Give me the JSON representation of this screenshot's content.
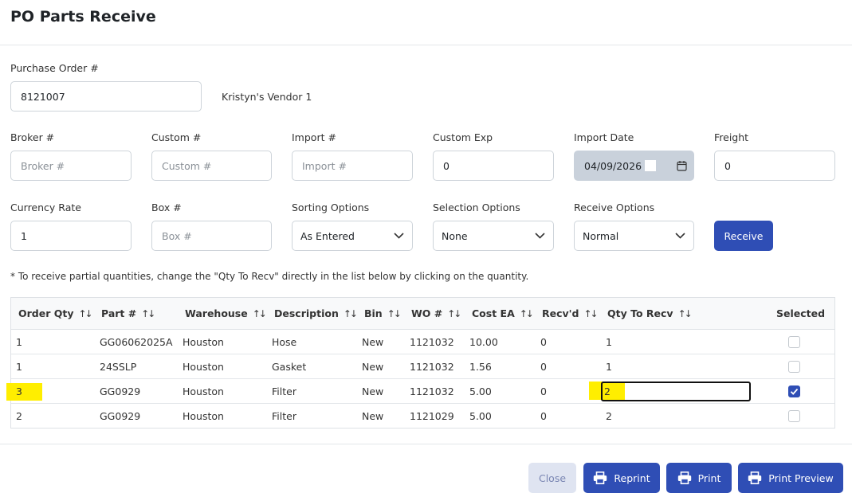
{
  "page": {
    "title": "PO Parts Receive"
  },
  "po": {
    "label": "Purchase Order #",
    "value": "8121007",
    "vendor": "Kristyn's Vendor 1"
  },
  "fields": {
    "broker": {
      "label": "Broker #",
      "placeholder": "Broker #",
      "value": ""
    },
    "custom": {
      "label": "Custom #",
      "placeholder": "Custom #",
      "value": ""
    },
    "import": {
      "label": "Import #",
      "placeholder": "Import #",
      "value": ""
    },
    "custom_exp": {
      "label": "Custom Exp",
      "value": "0"
    },
    "import_date": {
      "label": "Import Date",
      "value": "04/09/2026"
    },
    "freight": {
      "label": "Freight",
      "value": "0"
    },
    "currency_rate": {
      "label": "Currency Rate",
      "value": "1"
    },
    "box": {
      "label": "Box #",
      "placeholder": "Box #",
      "value": ""
    }
  },
  "options": {
    "sorting": {
      "label": "Sorting Options",
      "selected": "As Entered"
    },
    "selection": {
      "label": "Selection Options",
      "selected": "None"
    },
    "receive": {
      "label": "Receive Options",
      "selected": "Normal"
    },
    "receive_button": "Receive"
  },
  "note": "* To receive partial quantities, change the \"Qty To Recv\" directly in the list below by clicking on the quantity.",
  "table": {
    "sort_glyph": "↑↓",
    "headers": {
      "order_qty": "Order Qty",
      "part": "Part #",
      "warehouse": "Warehouse",
      "description": "Description",
      "bin": "Bin",
      "wo": "WO #",
      "cost": "Cost EA",
      "recvd": "Recv'd",
      "qty_to_recv": "Qty To Recv",
      "selected": "Selected"
    },
    "rows": [
      {
        "order_qty": "1",
        "part": "GG06062025A",
        "warehouse": "Houston",
        "description": "Hose",
        "bin": "New",
        "wo": "1121032",
        "cost": "10.00",
        "recvd": "0",
        "qty_to_recv": "1",
        "selected": false
      },
      {
        "order_qty": "1",
        "part": "24SSLP",
        "warehouse": "Houston",
        "description": "Gasket",
        "bin": "New",
        "wo": "1121032",
        "cost": "1.56",
        "recvd": "0",
        "qty_to_recv": "1",
        "selected": false
      },
      {
        "order_qty": "3",
        "part": "GG0929",
        "warehouse": "Houston",
        "description": "Filter",
        "bin": "New",
        "wo": "1121032",
        "cost": "5.00",
        "recvd": "0",
        "qty_to_recv": "2",
        "selected": true
      },
      {
        "order_qty": "2",
        "part": "GG0929",
        "warehouse": "Houston",
        "description": "Filter",
        "bin": "New",
        "wo": "1121029",
        "cost": "5.00",
        "recvd": "0",
        "qty_to_recv": "2",
        "selected": false
      }
    ]
  },
  "footer": {
    "close": "Close",
    "reprint": "Reprint",
    "print": "Print",
    "print_preview": "Print Preview"
  },
  "colors": {
    "primary": "#2f4eb5",
    "highlight": "#ffee00",
    "close_bg": "#dfe4f1",
    "disabled_bg": "#c9d1db"
  },
  "icons": {
    "calendar": "calendar-icon",
    "chevron": "chevron-down-icon",
    "printer": "printer-icon",
    "check": "check-icon"
  }
}
